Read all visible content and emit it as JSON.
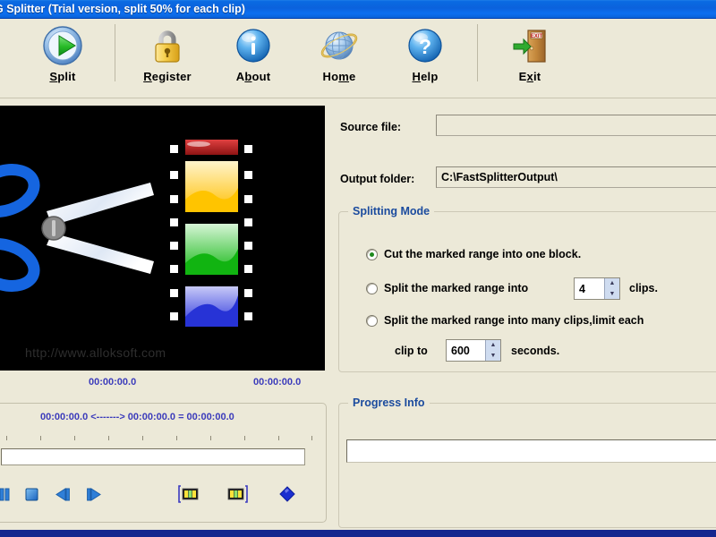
{
  "window": {
    "title": "G Splitter (Trial version, split 50% for each clip)",
    "title_bar_color": "#0b62dd",
    "background_color": "#ece9d8"
  },
  "toolbar": {
    "buttons": [
      {
        "label": "Split",
        "accel": "S",
        "icon": "play-circle-icon"
      },
      {
        "label": "Register",
        "accel": "R",
        "icon": "padlock-icon"
      },
      {
        "label": "About",
        "accel": "b",
        "icon": "info-circle-icon"
      },
      {
        "label": "Home",
        "accel": "m",
        "icon": "globe-icon"
      },
      {
        "label": "Help",
        "accel": "H",
        "icon": "question-circle-icon"
      },
      {
        "label": "Exit",
        "accel": "x",
        "icon": "exit-door-icon"
      }
    ]
  },
  "preview": {
    "watermark": "http://www.alloksoft.com",
    "start_time": "00:00:00.0",
    "end_time": "00:00:00.0"
  },
  "timeline": {
    "mark_summary": "00:00:00.0 <-------> 00:00:00.0 =  00:00:00.0",
    "controls": [
      {
        "name": "pause-button",
        "icon": "pause-icon"
      },
      {
        "name": "stop-button",
        "icon": "stop-icon"
      },
      {
        "name": "previous-frame-button",
        "icon": "prev-frame-icon"
      },
      {
        "name": "next-frame-button",
        "icon": "next-frame-icon"
      },
      {
        "name": "set-start-mark-button",
        "icon": "mark-start-icon"
      },
      {
        "name": "set-end-mark-button",
        "icon": "mark-end-icon"
      },
      {
        "name": "add-mark-button",
        "icon": "diamond-icon"
      }
    ]
  },
  "form": {
    "source_file_label": "Source file:",
    "source_file_value": "",
    "output_folder_label": "Output folder:",
    "output_folder_value": "C:\\FastSplitterOutput\\"
  },
  "splitting_mode": {
    "legend": "Splitting Mode",
    "legend_color": "#1b4b9e",
    "options": [
      {
        "label": "Cut the marked range into one block.",
        "selected": true
      },
      {
        "label": "Split the marked range into",
        "selected": false
      },
      {
        "label": "Split the marked range into many clips,limit each",
        "selected": false
      }
    ],
    "clips_value": "4",
    "clips_unit": "clips.",
    "clip_to_label": "clip to",
    "seconds_value": "600",
    "seconds_unit": "seconds."
  },
  "progress": {
    "legend": "Progress Info",
    "text": ""
  }
}
